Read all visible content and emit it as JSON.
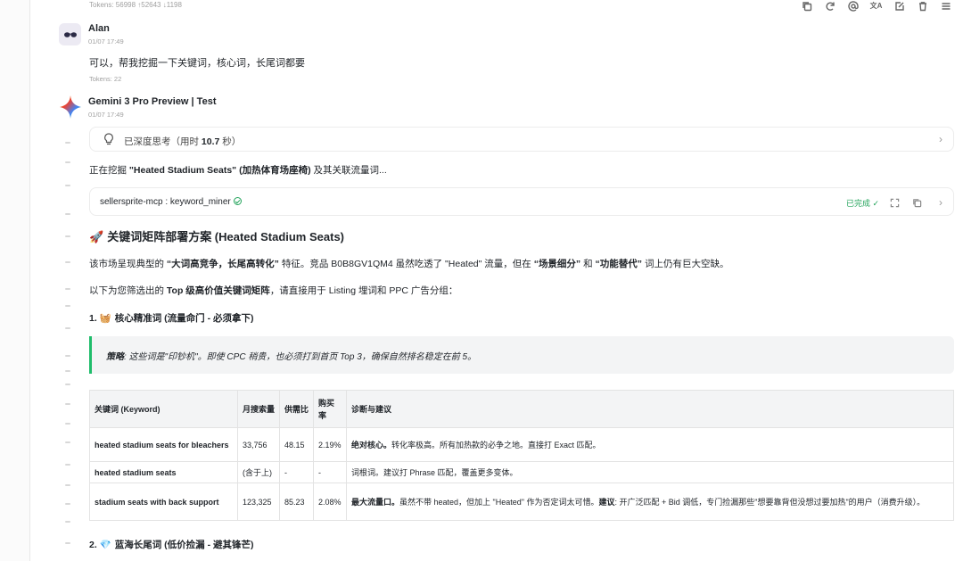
{
  "top_tokens": "Tokens: 56998 ↑52643 ↓1198",
  "toolbar": {
    "icons": [
      "copy-icon",
      "refresh-icon",
      "mention-icon",
      "translate-icon",
      "edit-icon",
      "delete-icon",
      "menu-icon"
    ],
    "translate_glyph": "文A"
  },
  "user_msg": {
    "name": "Alan",
    "date": "01/07 17:49",
    "text": "可以，帮我挖掘一下关键词，核心词，长尾词都要",
    "tokens": "Tokens: 22"
  },
  "assistant": {
    "name": "Gemini 3 Pro Preview | Test",
    "date": "01/07 17:49",
    "thinking": {
      "prefix": "已深度思考（用时 ",
      "time": "10.7",
      "suffix": " 秒）"
    },
    "intro_bold": "\"Heated Stadium Seats\" (加热体育场座椅)",
    "intro_pre": "正在挖掘 ",
    "intro_post": " 及其关联流量词...",
    "tool": {
      "name": "sellersprite-mcp : keyword_miner",
      "status": "已完成 ✓"
    },
    "heading": "关键词矩阵部署方案 (Heated Stadium Seats)",
    "heading_emoji": "🚀",
    "para1": {
      "a": "该市场呈现典型的 ",
      "b": "“大词高竞争，长尾高转化”",
      "c": " 特征。竞品 B0B8GV1QM4 虽然吃透了 \"Heated\" 流量，但在 ",
      "d": "“场景细分”",
      "e": " 和 ",
      "f": "“功能替代”",
      "g": " 词上仍有巨大空缺。"
    },
    "para2": {
      "a": "以下为您筛选出的 ",
      "b": "Top 级高价值关键词矩阵",
      "c": "，请直接用于 Listing 埋词和 PPC 广告分组："
    },
    "section1": {
      "prefix": "1. ",
      "emoji": "🧺",
      "title": "核心精准词 (流量命门 - 必须拿下)"
    },
    "strategy": {
      "label": "策略",
      "text": ": 这些词是\"印钞机\"。即使 CPC 稍贵，也必须打到首页 Top 3，确保自然排名稳定在前 5。"
    },
    "table": {
      "headers": [
        "关键词 (Keyword)",
        "月搜索量",
        "供需比",
        "购买率",
        "诊断与建议"
      ],
      "rows": [
        {
          "kw": "heated stadium seats for bleachers",
          "vol": "33,756",
          "ratio": "48.15",
          "rate": "2.19%",
          "note_b": "绝对核心。",
          "note": "转化率极高。所有加热款的必争之地。直接打 Exact 匹配。",
          "note_b2": "",
          "note2": ""
        },
        {
          "kw": "heated stadium seats",
          "vol": "(含于上)",
          "ratio": "-",
          "rate": "-",
          "note_b": "",
          "note": "词根词。建议打 Phrase 匹配，覆盖更多变体。",
          "note_b2": "",
          "note2": ""
        },
        {
          "kw": "stadium seats with back support",
          "vol": "123,325",
          "ratio": "85.23",
          "rate": "2.08%",
          "note_b": "最大流量口。",
          "note": "虽然不带 heated，但加上 \"Heated\" 作为否定词太可惜。",
          "note_b2": "建议",
          "note2": ": 开广泛匹配 + Bid 调低，专门捡漏那些\"想要靠背但没想过要加热\"的用户（消费升级）。"
        }
      ]
    },
    "section2": {
      "prefix": "2. ",
      "emoji": "💎",
      "title": "蓝海长尾词 (低价捡漏 - 避其锋芒)"
    }
  },
  "colors": {
    "accent_green": "#1fbd6b",
    "done_green": "#22a35a",
    "muted": "#a0a0a0"
  }
}
